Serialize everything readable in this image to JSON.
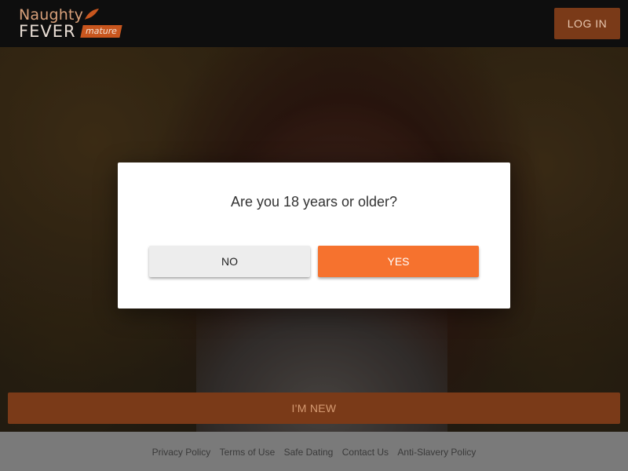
{
  "header": {
    "logo": {
      "line1": "Naughty",
      "line2": "FEVER",
      "tag": "mature"
    },
    "login_label": "LOG IN"
  },
  "modal": {
    "question": "Are you 18 years or older?",
    "no_label": "NO",
    "yes_label": "YES"
  },
  "cta": {
    "new_label": "I'M NEW"
  },
  "footer": {
    "links": [
      "Privacy Policy",
      "Terms of Use",
      "Safe Dating",
      "Contact Us",
      "Anti-Slavery Policy"
    ]
  },
  "colors": {
    "accent": "#f6722e",
    "accent_dim": "#7a3a18",
    "header_bg": "#0e0e0e",
    "footer_bg": "#7a7a7a"
  }
}
